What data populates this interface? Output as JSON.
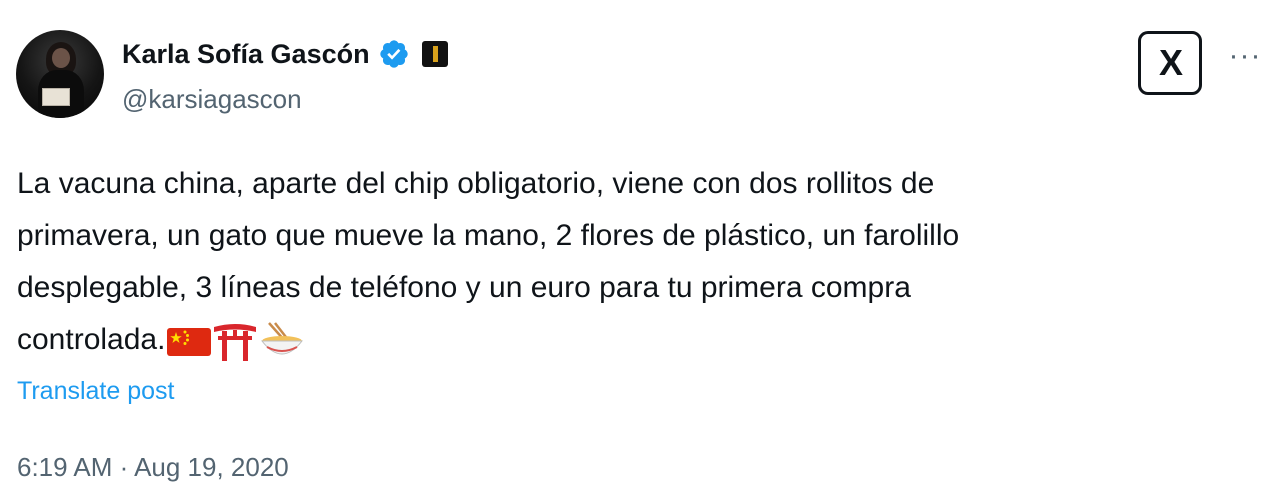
{
  "author": {
    "name": "Karla Sofía Gascón",
    "handle": "@karsiagascon",
    "verified": true,
    "avatar_icon": "profile-photo"
  },
  "icons": {
    "verified": "verified-badge-icon",
    "affiliate": "affiliate-badge-icon",
    "platform": "x-logo-icon",
    "more": "more-options-icon"
  },
  "platform_logo_text": "X",
  "more_label": "···",
  "tweet": {
    "lines": [
      "La vacuna china, aparte del chip obligatorio, viene con dos rollitos de",
      "primavera, un gato que mueve la mano, 2 flores de plástico, un farolillo",
      "desplegable, 3 líneas de teléfono y un euro para tu primera compra",
      "controlada."
    ],
    "emojis": [
      "flag-china",
      "torii-gate",
      "noodle-bowl"
    ]
  },
  "translate_label": "Translate post",
  "timestamp": "6:19 AM · Aug 19, 2020",
  "colors": {
    "text": "#0f1419",
    "secondary": "#536471",
    "link": "#1d9bf0",
    "verified": "#1d9bf0"
  }
}
